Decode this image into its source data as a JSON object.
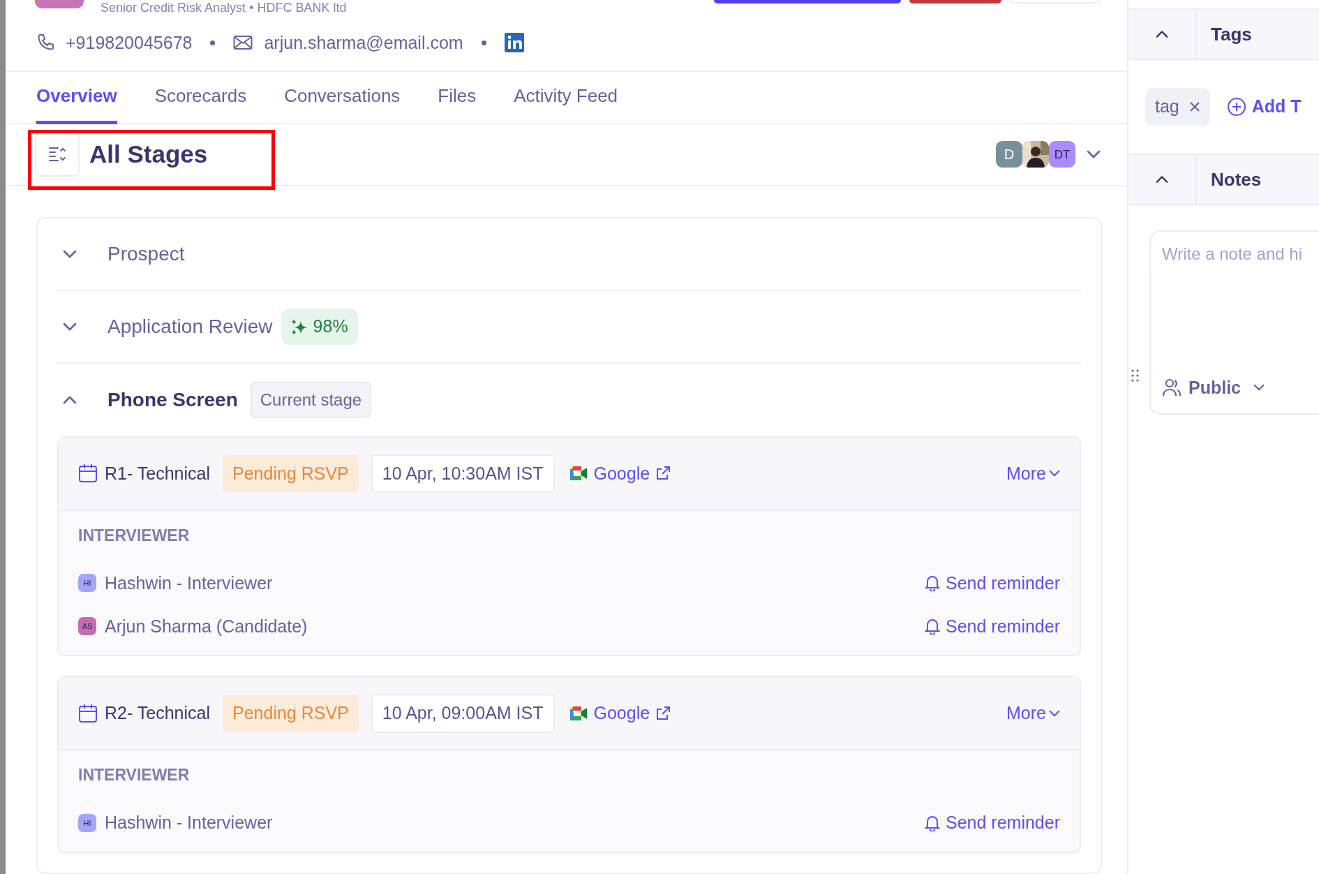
{
  "candidate": {
    "subtitle": "Senior Credit Risk Analyst • HDFC BANK ltd",
    "phone": "+919820045678",
    "email": "arjun.sharma@email.com"
  },
  "tabs": [
    {
      "label": "Overview",
      "selected": true
    },
    {
      "label": "Scorecards",
      "selected": false
    },
    {
      "label": "Conversations",
      "selected": false
    },
    {
      "label": "Files",
      "selected": false
    },
    {
      "label": "Activity Feed",
      "selected": false
    }
  ],
  "stage_header": {
    "title": "All Stages",
    "highlighted": true
  },
  "avatars": [
    {
      "kind": "initials",
      "initials": "D",
      "color": "#78909c"
    },
    {
      "kind": "picture"
    },
    {
      "kind": "initials",
      "initials": "DT",
      "color": "#a98bfa"
    }
  ],
  "stages": [
    {
      "name": "Prospect",
      "expanded": false
    },
    {
      "name": "Application Review",
      "expanded": false,
      "score": "98%"
    },
    {
      "name": "Phone Screen",
      "expanded": true,
      "badge": "Current stage",
      "interviews": [
        {
          "title": "R1- Technical",
          "status": "Pending RSVP",
          "time": "10 Apr, 10:30AM IST",
          "meeting": "Google",
          "more": "More",
          "section": "INTERVIEWER",
          "participants": [
            {
              "initials": "HI",
              "name": "Hashwin - Interviewer",
              "color": "#a3a6f6",
              "action": "Send reminder"
            },
            {
              "initials": "AS",
              "name": "Arjun Sharma (Candidate)",
              "color": "#c56bb3",
              "action": "Send reminder"
            }
          ]
        },
        {
          "title": "R2- Technical",
          "status": "Pending RSVP",
          "time": "10 Apr, 09:00AM IST",
          "meeting": "Google",
          "more": "More",
          "section": "INTERVIEWER",
          "participants": [
            {
              "initials": "HI",
              "name": "Hashwin - Interviewer",
              "color": "#a3a6f6",
              "action": "Send reminder"
            }
          ]
        }
      ]
    }
  ],
  "sidebar": {
    "tags": {
      "title": "Tags",
      "expanded": true,
      "items": [
        "tag"
      ],
      "add": "Add T"
    },
    "notes": {
      "title": "Notes",
      "expanded": true,
      "placeholder": "Write a note and hi",
      "visibility": "Public"
    }
  }
}
